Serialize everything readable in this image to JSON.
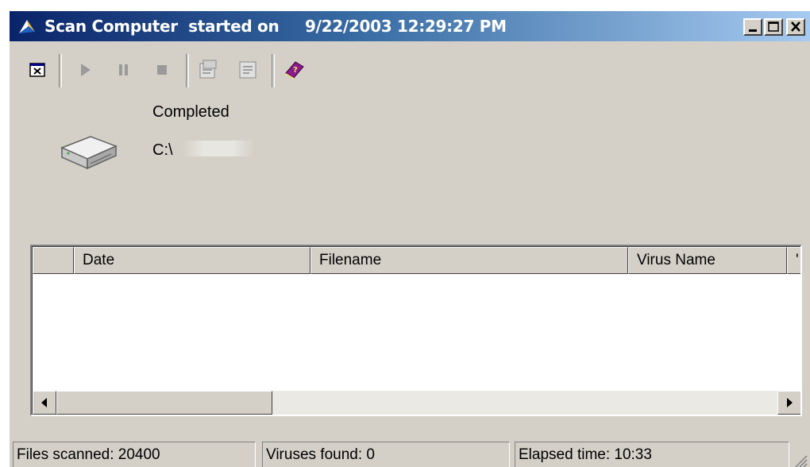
{
  "window": {
    "title": "Scan Computer  started on",
    "started": "9/22/2003 12:29:27 PM",
    "controls": [
      "minimize",
      "maximize",
      "close"
    ]
  },
  "toolbar": {
    "buttons": [
      {
        "name": "close-scan",
        "icon": "window-close-icon",
        "enabled": true
      },
      {
        "name": "start",
        "icon": "play-icon",
        "enabled": false
      },
      {
        "name": "pause",
        "icon": "pause-icon",
        "enabled": false
      },
      {
        "name": "stop",
        "icon": "stop-icon",
        "enabled": false
      },
      {
        "name": "properties",
        "icon": "properties-icon",
        "enabled": false
      },
      {
        "name": "report",
        "icon": "report-icon",
        "enabled": false
      },
      {
        "name": "help",
        "icon": "help-book-icon",
        "enabled": true
      }
    ]
  },
  "scan": {
    "status": "Completed",
    "path": "C:\\"
  },
  "results": {
    "columns": [
      "",
      "Date",
      "Filename",
      "Virus Name",
      "'"
    ],
    "rows": []
  },
  "statusbar": {
    "files_scanned": "Files scanned: 20400",
    "viruses_found": "Viruses found: 0",
    "elapsed": "Elapsed time:  10:33"
  },
  "colors": {
    "title_start": "#0a246a",
    "title_end": "#a6caf0",
    "face": "#d4d0c8",
    "help_book": "#8b1a8b"
  }
}
